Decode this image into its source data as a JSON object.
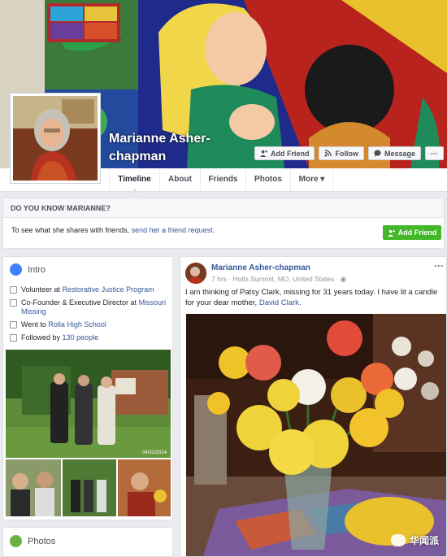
{
  "profile": {
    "name": "Marianne Asher-chapman",
    "buttons": {
      "add_friend": "Add Friend",
      "follow": "Follow",
      "message": "Message",
      "more": "···"
    }
  },
  "tabs": [
    "Timeline",
    "About",
    "Friends",
    "Photos",
    "More ▾"
  ],
  "know": {
    "heading": "DO YOU KNOW MARIANNE?",
    "text_prefix": "To see what she shares with friends, ",
    "link": "send her a friend request.",
    "button": "Add Friend"
  },
  "intro": {
    "title": "Intro",
    "items": [
      {
        "prefix": "Volunteer at ",
        "link": "Restorative Justice Program",
        "icon": "briefcase-icon"
      },
      {
        "prefix": "Co-Founder & Executive Director at ",
        "link": "Missouri Missing",
        "icon": "briefcase-icon"
      },
      {
        "prefix": "Went to ",
        "link": "Rolla High School",
        "icon": "graduation-cap-icon"
      },
      {
        "prefix": "Followed by ",
        "link": "130 people",
        "icon": "rss-icon"
      }
    ],
    "photo_date": "04/02/2014"
  },
  "photos_card": {
    "title": "Photos"
  },
  "post": {
    "author": "Marianne Asher-chapman",
    "meta": "7 hrs · Holts Summit, MO, United States · ",
    "text": "I am thinking of Patsy Clark, missing for 31 years today. I have lit a candle for your dear mother, ",
    "link": "David Clark",
    "text_end": ".",
    "more": "···"
  },
  "watermark": "华闻派",
  "colors": {
    "facebook_blue": "#365899",
    "green_button": "#42b72a",
    "page_bg": "#e9ebee"
  }
}
